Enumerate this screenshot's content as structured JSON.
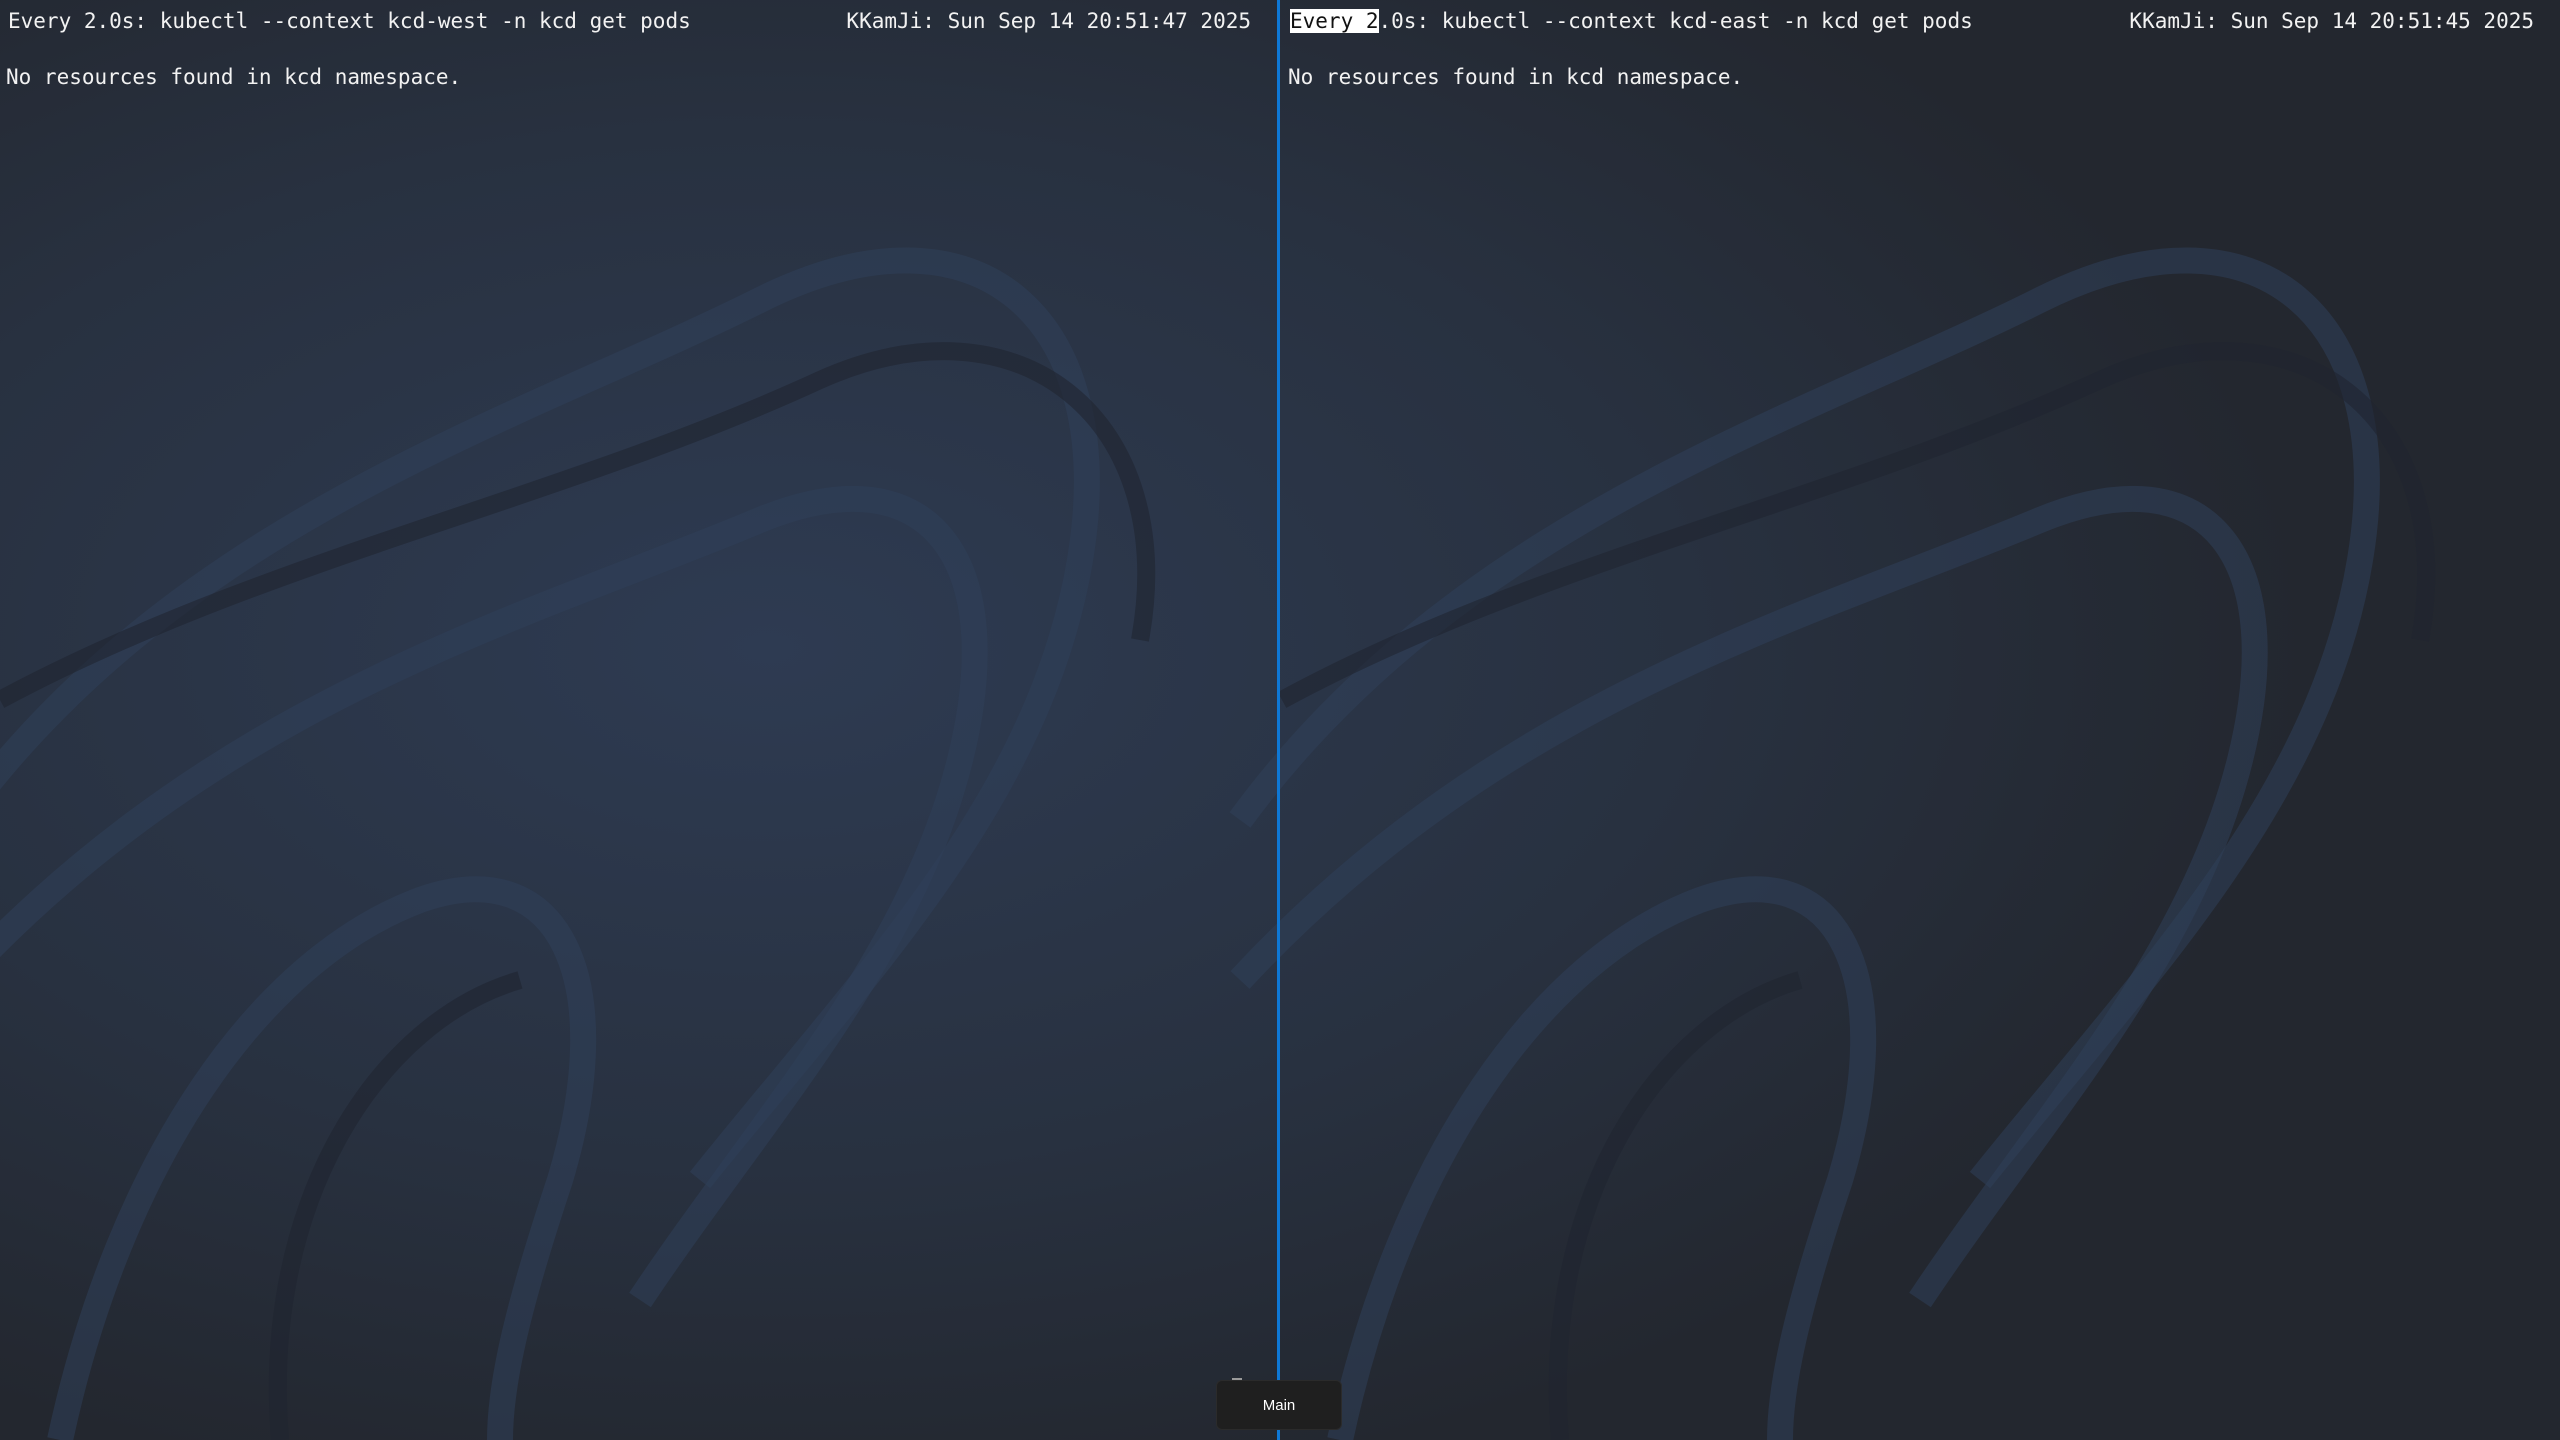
{
  "left_pane": {
    "header_left": "Every 2.0s: kubectl --context kcd-west -n kcd get pods",
    "header_right": "KKamJi: Sun Sep 14 20:51:47 2025",
    "output": "No resources found in kcd namespace."
  },
  "right_pane": {
    "header_selected": "Every 2",
    "header_rest": ".0s: kubectl --context kcd-east -n kcd get pods",
    "header_right": "KKamJi: Sun Sep 14 20:51:45 2025",
    "output": "No resources found in kcd namespace."
  },
  "taskbar": {
    "tab_label": "Main"
  },
  "colors": {
    "background": "#262b35",
    "text": "#f2f2f2",
    "divider": "#0e78d6"
  }
}
